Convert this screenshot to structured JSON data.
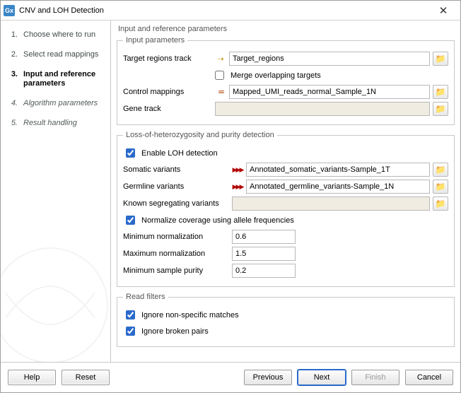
{
  "window": {
    "logo": "Gx",
    "title": "CNV and LOH Detection"
  },
  "steps": [
    {
      "num": "1.",
      "label": "Choose where to run",
      "state": "done"
    },
    {
      "num": "2.",
      "label": "Select read mappings",
      "state": "done"
    },
    {
      "num": "3.",
      "label": "Input and reference parameters",
      "state": "active"
    },
    {
      "num": "4.",
      "label": "Algorithm parameters",
      "state": "upcoming"
    },
    {
      "num": "5.",
      "label": "Result handling",
      "state": "upcoming"
    }
  ],
  "content": {
    "heading": "Input and reference parameters",
    "group_input": {
      "legend": "Input parameters",
      "target_label": "Target regions track",
      "target_value": "Target_regions",
      "merge_label": "Merge overlapping targets",
      "merge_checked": false,
      "control_label": "Control mappings",
      "control_value": "Mapped_UMI_reads_normal_Sample_1N",
      "gene_label": "Gene track",
      "gene_value": ""
    },
    "group_loh": {
      "legend": "Loss-of-heterozygosity and purity detection",
      "enable_label": "Enable LOH detection",
      "enable_checked": true,
      "somatic_label": "Somatic variants",
      "somatic_value": "Annotated_somatic_variants-Sample_1T",
      "germline_label": "Germline variants",
      "germline_value": "Annotated_germline_variants-Sample_1N",
      "known_label": "Known segregating variants",
      "known_value": "",
      "normalize_label": "Normalize coverage using allele frequencies",
      "normalize_checked": true,
      "min_norm_label": "Minimum normalization",
      "min_norm_value": "0.6",
      "max_norm_label": "Maximum normalization",
      "max_norm_value": "1.5",
      "min_purity_label": "Minimum sample purity",
      "min_purity_value": "0.2"
    },
    "group_filters": {
      "legend": "Read filters",
      "ignore_nonspec_label": "Ignore non-specific matches",
      "ignore_nonspec_checked": true,
      "ignore_broken_label": "Ignore broken pairs",
      "ignore_broken_checked": true
    }
  },
  "footer": {
    "help": "Help",
    "reset": "Reset",
    "previous": "Previous",
    "next": "Next",
    "finish": "Finish",
    "cancel": "Cancel"
  }
}
